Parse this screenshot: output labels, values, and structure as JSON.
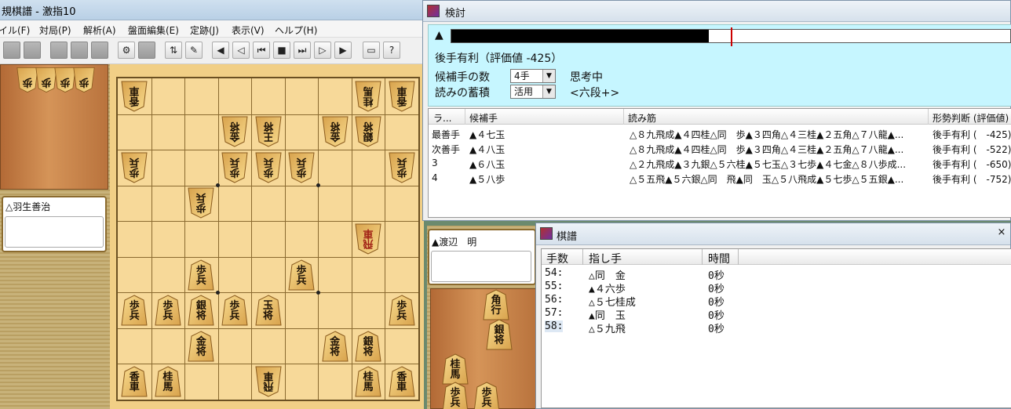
{
  "app": {
    "title": "規棋譜 - 激指10",
    "menu": [
      "イル(F)",
      "対局(P)",
      "解析(A)",
      "盤面編集(E)",
      "定跡(J)",
      "表示(V)",
      "ヘルプ(H)"
    ]
  },
  "players": {
    "gote": {
      "name": "△羽生善治"
    },
    "sente": {
      "name": "▲渡辺　明"
    }
  },
  "hands": {
    "gote": [
      [
        "歩",
        ""
      ],
      [
        "歩",
        ""
      ],
      [
        "歩",
        ""
      ],
      [
        "歩",
        ""
      ]
    ],
    "sente": [
      [
        "角",
        "行"
      ],
      [
        "銀",
        "将"
      ],
      [
        "桂",
        "馬"
      ],
      [
        "歩",
        "兵"
      ],
      [
        "歩",
        "兵"
      ]
    ]
  },
  "board": {
    "pieces": [
      {
        "f": 9,
        "r": 1,
        "t": "香",
        "b": "車",
        "side": "gote"
      },
      {
        "f": 2,
        "r": 1,
        "t": "桂",
        "b": "馬",
        "side": "gote"
      },
      {
        "f": 1,
        "r": 1,
        "t": "香",
        "b": "車",
        "side": "gote"
      },
      {
        "f": 6,
        "r": 2,
        "t": "金",
        "b": "将",
        "side": "gote"
      },
      {
        "f": 5,
        "r": 2,
        "t": "王",
        "b": "将",
        "side": "gote"
      },
      {
        "f": 3,
        "r": 2,
        "t": "金",
        "b": "将",
        "side": "gote"
      },
      {
        "f": 2,
        "r": 2,
        "t": "銀",
        "b": "将",
        "side": "gote"
      },
      {
        "f": 9,
        "r": 3,
        "t": "歩",
        "b": "兵",
        "side": "gote"
      },
      {
        "f": 6,
        "r": 3,
        "t": "歩",
        "b": "兵",
        "side": "gote"
      },
      {
        "f": 5,
        "r": 3,
        "t": "歩",
        "b": "兵",
        "side": "gote"
      },
      {
        "f": 4,
        "r": 3,
        "t": "歩",
        "b": "兵",
        "side": "gote"
      },
      {
        "f": 1,
        "r": 3,
        "t": "歩",
        "b": "兵",
        "side": "gote"
      },
      {
        "f": 7,
        "r": 4,
        "t": "歩",
        "b": "兵",
        "side": "gote"
      },
      {
        "f": 2,
        "r": 5,
        "t": "飛",
        "b": "車",
        "side": "gote",
        "promoted": true
      },
      {
        "f": 7,
        "r": 6,
        "t": "歩",
        "b": "兵",
        "side": "sente"
      },
      {
        "f": 4,
        "r": 6,
        "t": "歩",
        "b": "兵",
        "side": "sente"
      },
      {
        "f": 9,
        "r": 7,
        "t": "歩",
        "b": "兵",
        "side": "sente"
      },
      {
        "f": 8,
        "r": 7,
        "t": "歩",
        "b": "兵",
        "side": "sente"
      },
      {
        "f": 7,
        "r": 7,
        "t": "銀",
        "b": "将",
        "side": "sente"
      },
      {
        "f": 6,
        "r": 7,
        "t": "歩",
        "b": "兵",
        "side": "sente"
      },
      {
        "f": 5,
        "r": 7,
        "t": "玉",
        "b": "将",
        "side": "sente"
      },
      {
        "f": 1,
        "r": 7,
        "t": "歩",
        "b": "兵",
        "side": "sente"
      },
      {
        "f": 7,
        "r": 8,
        "t": "金",
        "b": "将",
        "side": "sente"
      },
      {
        "f": 3,
        "r": 8,
        "t": "金",
        "b": "将",
        "side": "sente"
      },
      {
        "f": 2,
        "r": 8,
        "t": "銀",
        "b": "将",
        "side": "sente"
      },
      {
        "f": 9,
        "r": 9,
        "t": "香",
        "b": "車",
        "side": "sente"
      },
      {
        "f": 8,
        "r": 9,
        "t": "桂",
        "b": "馬",
        "side": "sente"
      },
      {
        "f": 5,
        "r": 9,
        "t": "飛",
        "b": "車",
        "side": "gote"
      },
      {
        "f": 2,
        "r": 9,
        "t": "桂",
        "b": "馬",
        "side": "sente"
      },
      {
        "f": 1,
        "r": 9,
        "t": "香",
        "b": "車",
        "side": "sente"
      }
    ]
  },
  "analysis": {
    "title": "検討",
    "eval_mark": "▲",
    "eval_fill": 0.46,
    "eval_marker": 0.5,
    "eval_text": "後手有利（評価値 -425）",
    "candidates_label": "候補手の数",
    "candidates_value": "4手",
    "status_text": "思考中",
    "accumulate_label": "読みの蓄積",
    "accumulate_value": "活用",
    "level_text": "<六段+>",
    "columns": [
      "ラ...",
      "候補手",
      "読み筋",
      "形勢判断 (評価値)"
    ],
    "rows": [
      {
        "rank": "最善手",
        "move": "▲４七玉",
        "line": "△８九飛成▲４四桂△同　歩▲３四角△４三桂▲２五角△７八龍▲...",
        "judge": "後手有利 (　-425)"
      },
      {
        "rank": "次善手",
        "move": "▲４八玉",
        "line": "△８九飛成▲４四桂△同　歩▲３四角△４三桂▲２五角△７八龍▲...",
        "judge": "後手有利 (　-522)"
      },
      {
        "rank": "3",
        "move": "▲６八玉",
        "line": "△２九飛成▲３九銀△５六桂▲５七玉△３七歩▲４七金△８八歩成...",
        "judge": "後手有利 (　-650)"
      },
      {
        "rank": "4",
        "move": "▲５八歩",
        "line": "△５五飛▲５六銀△同　飛▲同　玉△５八飛成▲５七歩△５五銀▲...",
        "judge": "後手有利 (　-752)"
      }
    ]
  },
  "kifu": {
    "title": "棋譜",
    "close": "×",
    "columns": [
      "手数",
      "指し手",
      "時間"
    ],
    "moves": [
      {
        "n": "54:",
        "move": "△同　金",
        "time": "0秒"
      },
      {
        "n": "55:",
        "move": "▲４六歩",
        "time": "0秒"
      },
      {
        "n": "56:",
        "move": "△５七桂成",
        "time": "0秒"
      },
      {
        "n": "57:",
        "move": "▲同　玉",
        "time": "0秒"
      },
      {
        "n": "58:",
        "move": "△５九飛",
        "time": "0秒"
      }
    ]
  },
  "colors": {
    "board": "#f7d999",
    "info_bg": "#c6f6ff",
    "hand_wood": "#c98548"
  }
}
